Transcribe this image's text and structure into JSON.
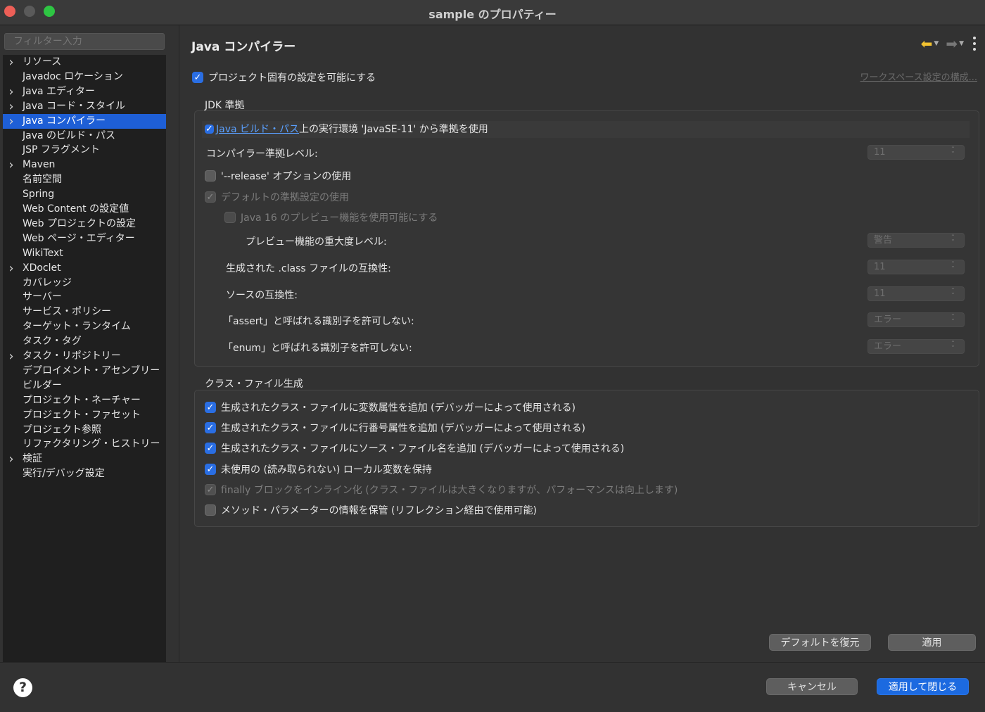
{
  "window": {
    "title": "sample のプロパティー"
  },
  "sidebar": {
    "filter_placeholder": "フィルター入力",
    "items": [
      {
        "label": "リソース",
        "expandable": true
      },
      {
        "label": "Javadoc ロケーション",
        "expandable": false
      },
      {
        "label": "Java エディター",
        "expandable": true
      },
      {
        "label": "Java コード・スタイル",
        "expandable": true
      },
      {
        "label": "Java コンパイラー",
        "expandable": true,
        "selected": true
      },
      {
        "label": "Java のビルド・パス",
        "expandable": false
      },
      {
        "label": "JSP フラグメント",
        "expandable": false
      },
      {
        "label": "Maven",
        "expandable": true
      },
      {
        "label": "名前空間",
        "expandable": false
      },
      {
        "label": "Spring",
        "expandable": false
      },
      {
        "label": "Web Content の設定値",
        "expandable": false
      },
      {
        "label": "Web プロジェクトの設定",
        "expandable": false
      },
      {
        "label": "Web ページ・エディター",
        "expandable": false
      },
      {
        "label": "WikiText",
        "expandable": false
      },
      {
        "label": "XDoclet",
        "expandable": true
      },
      {
        "label": "カバレッジ",
        "expandable": false
      },
      {
        "label": "サーバー",
        "expandable": false
      },
      {
        "label": "サービス・ポリシー",
        "expandable": false
      },
      {
        "label": "ターゲット・ランタイム",
        "expandable": false
      },
      {
        "label": "タスク・タグ",
        "expandable": false
      },
      {
        "label": "タスク・リポジトリー",
        "expandable": true
      },
      {
        "label": "デプロイメント・アセンブリー",
        "expandable": false
      },
      {
        "label": "ビルダー",
        "expandable": false
      },
      {
        "label": "プロジェクト・ネーチャー",
        "expandable": false
      },
      {
        "label": "プロジェクト・ファセット",
        "expandable": false
      },
      {
        "label": "プロジェクト参照",
        "expandable": false
      },
      {
        "label": "リファクタリング・ヒストリー",
        "expandable": false
      },
      {
        "label": "検証",
        "expandable": true
      },
      {
        "label": "実行/デバッグ設定",
        "expandable": false
      }
    ]
  },
  "page": {
    "title": "Java コンパイラー",
    "enable_project_settings": "プロジェクト固有の設定を可能にする",
    "workspace_link": "ワークスペース設定の構成...",
    "jdk": {
      "title": "JDK 準拠",
      "use_env_link": "Java ビルド・パス",
      "use_env_suffix": "上の実行環境 'JavaSE-11' から準拠を使用",
      "compliance_label": "コンパイラー準拠レベル:",
      "compliance_value": "11",
      "release_option": "'--release' オプションの使用",
      "default_compliance": "デフォルトの準拠設定の使用",
      "preview_enable": "Java 16 のプレビュー機能を使用可能にする",
      "preview_severity_label": "プレビュー機能の重大度レベル:",
      "preview_severity_value": "警告",
      "class_compat_label": "生成された .class ファイルの互換性:",
      "class_compat_value": "11",
      "source_compat_label": "ソースの互換性:",
      "source_compat_value": "11",
      "assert_label": "「assert」と呼ばれる識別子を許可しない:",
      "assert_value": "エラー",
      "enum_label": "「enum」と呼ばれる識別子を許可しない:",
      "enum_value": "エラー"
    },
    "classfile": {
      "title": "クラス・ファイル生成",
      "opt1": "生成されたクラス・ファイルに変数属性を追加 (デバッガーによって使用される)",
      "opt2": "生成されたクラス・ファイルに行番号属性を追加 (デバッガーによって使用される)",
      "opt3": "生成されたクラス・ファイルにソース・ファイル名を追加 (デバッガーによって使用される)",
      "opt4": "未使用の (読み取られない) ローカル変数を保持",
      "opt5": "finally ブロックをインライン化 (クラス・ファイルは大きくなりますが、パフォーマンスは向上します)",
      "opt6": "メソッド・パラメーターの情報を保管 (リフレクション経由で使用可能)"
    },
    "restore_defaults": "デフォルトを復元",
    "apply": "適用"
  },
  "footer": {
    "help": "?",
    "cancel": "キャンセル",
    "apply_close": "適用して閉じる"
  }
}
